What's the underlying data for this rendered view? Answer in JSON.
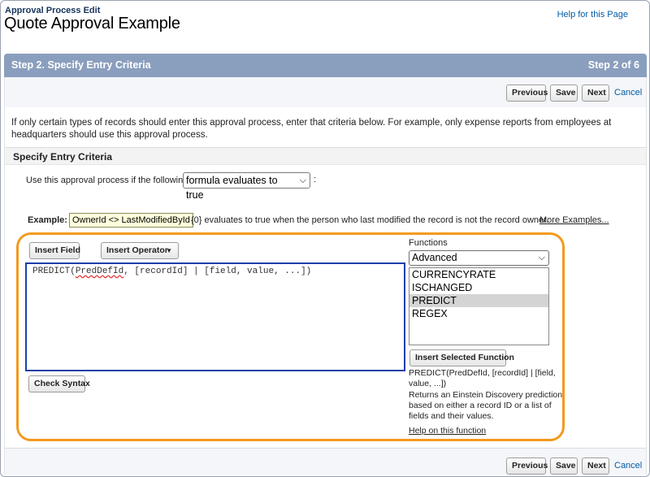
{
  "page": {
    "breadcrumb": "Approval Process Edit",
    "title": "Quote Approval Example",
    "help_link": "Help for this Page"
  },
  "step": {
    "title": "Step 2. Specify Entry Criteria",
    "count": "Step 2 of 6"
  },
  "buttons": {
    "previous": "Previous",
    "save": "Save",
    "next": "Next",
    "cancel": "Cancel",
    "insert_field": "Insert Field",
    "insert_operator": "Insert Operator",
    "check_syntax": "Check Syntax",
    "insert_selected_function": "Insert Selected Function"
  },
  "intro_text": "If only certain types of records should enter this approval process, enter that criteria below. For example, only expense reports from employees at headquarters should use this approval process.",
  "section_title": "Specify Entry Criteria",
  "criteria": {
    "label": "Use this approval process if the following",
    "selected": "formula evaluates to true",
    "colon": ":"
  },
  "example": {
    "label": "Example:",
    "formula": "OwnerId <> LastModifiedById",
    "description": "{0} evaluates to true when the person who last modified the record is not the record owner.",
    "more_link": "More Examples..."
  },
  "formula": {
    "prefix": "PREDICT(",
    "misspelled": "PredDefId",
    "suffix": ", [recordId] | [field, value, ...])"
  },
  "functions": {
    "label": "Functions",
    "category": "Advanced",
    "items": [
      "CURRENCYRATE",
      "ISCHANGED",
      "PREDICT",
      "REGEX"
    ],
    "selected_index": 2,
    "syntax": "PREDICT(PredDefId, [recordId] | [field, value, ...])",
    "description": "Returns an Einstein Discovery prediction based on either a record ID or a list of fields and their values.",
    "help_link": "Help on this function"
  },
  "colors": {
    "step_bar": "#8a9ebe",
    "highlight_border": "#f39a1e",
    "formula_border": "#1a40a8",
    "link": "#015ba7"
  }
}
